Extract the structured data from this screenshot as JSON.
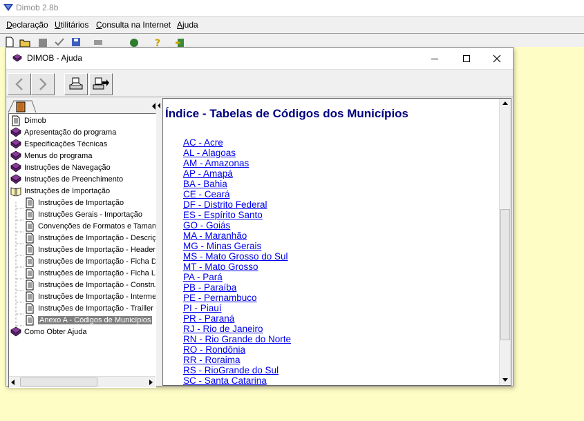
{
  "app": {
    "title": "Dimob 2.8b",
    "menu": [
      "Declaração",
      "Utilitários",
      "Consulta na Internet",
      "Ajuda"
    ]
  },
  "help": {
    "title": "DIMOB - Ajuda",
    "tree": [
      {
        "label": "Dimob",
        "icon": "page-icon",
        "level": 0
      },
      {
        "label": "Apresentação do programa",
        "icon": "book-icon",
        "level": 0
      },
      {
        "label": "Especificações Técnicas",
        "icon": "book-icon",
        "level": 0
      },
      {
        "label": "Menus do programa",
        "icon": "book-icon",
        "level": 0
      },
      {
        "label": "Instruções de Navegação",
        "icon": "book-icon",
        "level": 0
      },
      {
        "label": "Instruções de Preenchimento",
        "icon": "book-icon",
        "level": 0
      },
      {
        "label": "Instruções de Importação",
        "icon": "open-book-icon",
        "level": 0
      },
      {
        "label": "Instruções de Importação",
        "icon": "page-icon",
        "level": 1
      },
      {
        "label": "Instruções Gerais - Importação",
        "icon": "page-icon",
        "level": 1
      },
      {
        "label": "Convenções de Formatos e Taman",
        "icon": "page-icon",
        "level": 1
      },
      {
        "label": "Instruções de Importação - Descriç",
        "icon": "page-icon",
        "level": 1
      },
      {
        "label": "Instruções de Importação - Header",
        "icon": "page-icon",
        "level": 1
      },
      {
        "label": "Instruções de Importação - Ficha D",
        "icon": "page-icon",
        "level": 1
      },
      {
        "label": "Instruções de Importação - Ficha L",
        "icon": "page-icon",
        "level": 1
      },
      {
        "label": "Instruções de Importação - Constru",
        "icon": "page-icon",
        "level": 1
      },
      {
        "label": "Instruções de Importação - Interme",
        "icon": "page-icon",
        "level": 1
      },
      {
        "label": "Instruções de Importação - Trailler",
        "icon": "page-icon",
        "level": 1
      },
      {
        "label": "Anexo A - Códigos de Municípios",
        "icon": "page-icon",
        "level": 1,
        "selected": true
      },
      {
        "label": "Como Obter Ajuda",
        "icon": "book-icon",
        "level": 0
      }
    ],
    "content": {
      "heading": "Índice - Tabelas de Códigos dos Municípios",
      "links": [
        "AC - Acre",
        "AL - Alagoas",
        "AM - Amazonas",
        "AP - Amapá",
        "BA - Bahia",
        "CE - Ceará",
        "DF - Distrito Federal",
        "ES - Espírito Santo",
        "GO - Goiás",
        "MA - Maranhão",
        "MG - Minas Gerais",
        "MS - Mato Grosso do Sul",
        "MT - Mato Grosso",
        "PA - Pará",
        "PB - Paraíba",
        "PE - Pernambuco",
        "PI - Piauí",
        "PR - Paraná",
        "RJ - Rio de Janeiro",
        "RN - Rio Grande do Norte",
        "RO - Rondônia",
        "RR - Roraima",
        "RS - RioGrande do Sul",
        "SC - Santa Catarina"
      ]
    }
  },
  "colors": {
    "desktop": "#fffdc6",
    "heading": "#000080",
    "link": "#0000ee",
    "selection": "#808080"
  }
}
